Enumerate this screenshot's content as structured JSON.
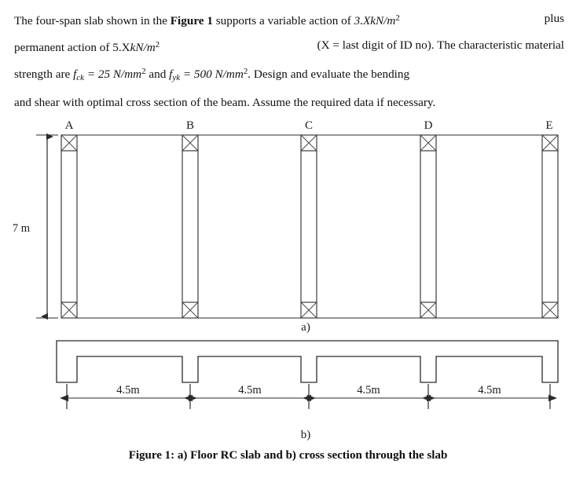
{
  "document": {
    "statement": {
      "lines": [
        [
          {
            "t": "The four-span slab shown in the ",
            "s": "plain"
          },
          {
            "t": "Figure 1",
            "s": "bold"
          },
          {
            "t": " supports a variable action of ",
            "s": "plain"
          },
          {
            "t": "3.X",
            "s": "ital"
          },
          {
            "t": "kN/m",
            "s": "ital"
          },
          {
            "t": "2",
            "s": "sup"
          },
          {
            "t": " plus",
            "s": "plain"
          }
        ],
        [
          {
            "t": "permanent action of 5.X",
            "s": "plain-ital-mix"
          },
          {
            "t": "kN/m",
            "s": "ital"
          },
          {
            "t": "2",
            "s": "sup"
          },
          {
            "t": " (X = last digit of ID no). The characteristic material",
            "s": "plain"
          }
        ],
        [
          {
            "t": "strength are ",
            "s": "plain"
          },
          {
            "t": "f",
            "s": "ital"
          },
          {
            "t": "ck",
            "s": "sub"
          },
          {
            "t": " = 25 N/mm",
            "s": "ital"
          },
          {
            "t": "2",
            "s": "sup"
          },
          {
            "t": " and ",
            "s": "plain"
          },
          {
            "t": "f",
            "s": "ital"
          },
          {
            "t": "yk",
            "s": "sub"
          },
          {
            "t": " = 500 N/mm",
            "s": "ital"
          },
          {
            "t": "2",
            "s": "sup"
          },
          {
            "t": ". Design and evaluate the bending",
            "s": "plain"
          }
        ],
        [
          {
            "t": "and shear with optimal cross section of the beam. Assume the required data if necessary.",
            "s": "plain"
          }
        ]
      ],
      "line1_a": "The four-span slab shown in the ",
      "line1_figref": "Figure 1",
      "line1_b": " supports a variable action of ",
      "line1_val": "3.X",
      "line1_unit": "kN/m",
      "line1_exp": "2",
      "line1_c": " plus",
      "line2_a": "permanent action of 5.X",
      "line2_unit": "kN/m",
      "line2_exp": "2",
      "line2_b": " (X = last digit of ID no). The characteristic material",
      "line3_a": "strength are ",
      "line3_f1": "f",
      "line3_sub1": "ck",
      "line3_b": " = 25 N/mm",
      "line3_exp1": "2",
      "line3_c": " and ",
      "line3_f2": "f",
      "line3_sub2": "yk",
      "line3_d": " = 500 N/mm",
      "line3_exp2": "2",
      "line3_e": ". Design and evaluate the bending",
      "line4": "and shear with optimal cross section of the beam. Assume the required data if necessary."
    },
    "caption": "Figure 1: a) Floor RC slab and b) cross section through the slab"
  },
  "figure": {
    "part_a": {
      "label": "a)",
      "column_labels": [
        "A",
        "B",
        "C",
        "D",
        "E"
      ],
      "vertical_dimension": "7 m",
      "span_height_m": 7,
      "column_count": 5,
      "span_count": 4
    },
    "part_b": {
      "label": "b)",
      "span_dimensions": [
        "4.5m",
        "4.5m",
        "4.5m",
        "4.5m"
      ],
      "span_length_m": 4.5,
      "stem_count": 5,
      "description": "cross section through the slab showing downstand beams"
    }
  },
  "colors": {
    "line": "#2b2b2b",
    "line_light": "#4a4a4a",
    "text": "#111111",
    "background": "#ffffff"
  }
}
